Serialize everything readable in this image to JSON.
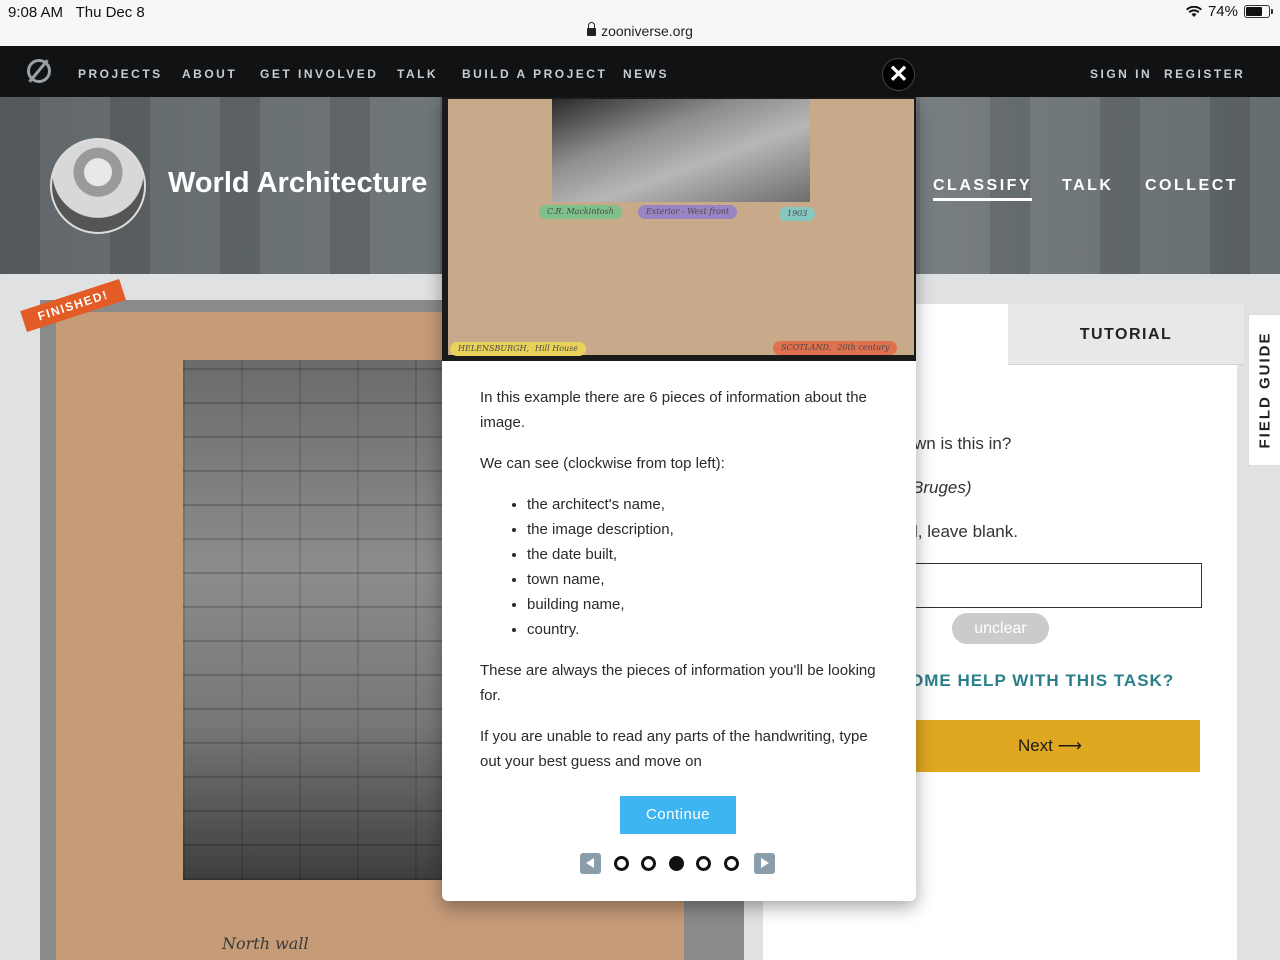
{
  "status_bar": {
    "time": "9:08 AM",
    "date": "Thu Dec 8",
    "url": "zooniverse.org",
    "battery": "74%",
    "battery_level": 0.74
  },
  "top_nav": {
    "links": [
      "PROJECTS",
      "ABOUT",
      "GET INVOLVED",
      "TALK",
      "BUILD A PROJECT",
      "NEWS"
    ],
    "sign_in": "SIGN IN",
    "register": "REGISTER"
  },
  "project": {
    "title": "World Architecture",
    "links": [
      "CLASSIFY",
      "TALK",
      "COLLECT"
    ],
    "active_link": "CLASSIFY"
  },
  "subject": {
    "badge": "FINISHED!",
    "handwriting": "North wall"
  },
  "task": {
    "tutorial_tab": "TUTORIAL",
    "question_fragment": "wn is this in?",
    "example_fragment": "Bruges)",
    "instruction_fragment": "l, leave blank.",
    "unclear_label": "unclear",
    "help_fragment": "OME HELP WITH THIS TASK?",
    "next_label": "Next",
    "field_guide": "FIELD GUIDE"
  },
  "modal": {
    "close_icon": "close-icon",
    "tags": {
      "architect": "C.R. Mackintosh",
      "description": "Exterior - West front",
      "date": "1903",
      "town": "HELENSBURGH,",
      "building": "Hill House",
      "country": "SCOTLAND,",
      "period": "20th century"
    },
    "paragraphs": {
      "p1": "In this example there are 6 pieces of information about the image.",
      "p2": "We can see (clockwise from top left):",
      "p3": "These are always the pieces of information you'll be looking for.",
      "p4": "If you are unable to read any parts of the handwriting, type out your best guess and move on"
    },
    "list": [
      "the architect's name,",
      "the image description,",
      "the date built,",
      "town name,",
      "building name,",
      "country."
    ],
    "continue_label": "Continue",
    "pager": {
      "total_steps": 5,
      "current_step": 3
    }
  }
}
